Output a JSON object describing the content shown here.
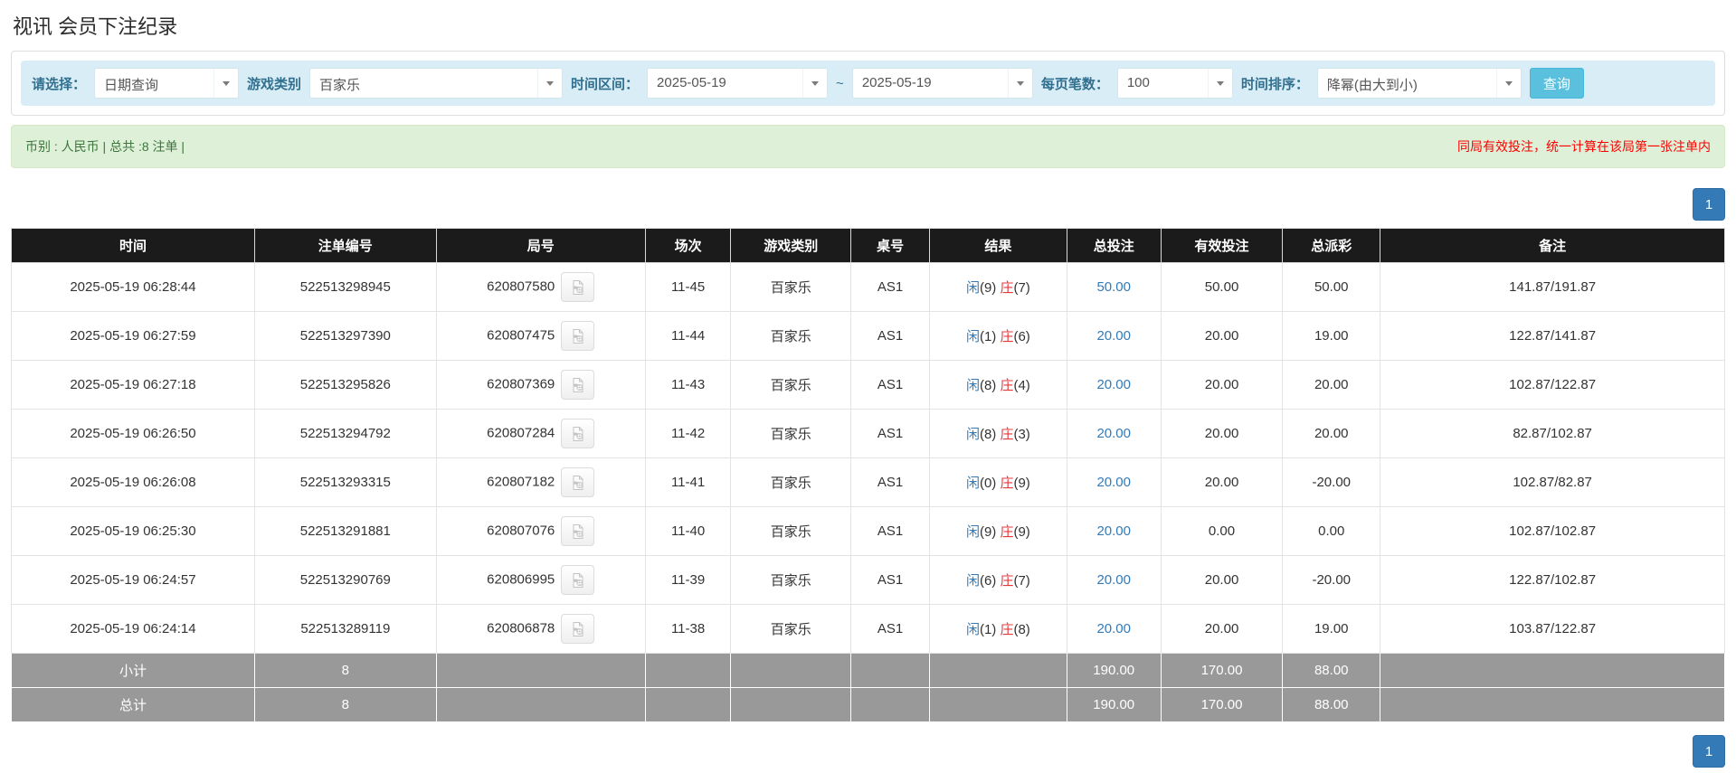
{
  "page": {
    "title": "视讯 会员下注纪录"
  },
  "filters": {
    "select_label": "请选择：",
    "select_value": "日期查询",
    "game_type_label": "游戏类别",
    "game_type_value": "百家乐",
    "time_range_label": "时间区间：",
    "date_from": "2025-05-19",
    "tilde": "~",
    "date_to": "2025-05-19",
    "page_size_label": "每页笔数：",
    "page_size_value": "100",
    "sort_label": "时间排序：",
    "sort_value": "降幂(由大到小)",
    "search_button": "查询"
  },
  "summary": {
    "left": "币别 : 人民币 | 总共 :8 注单 |",
    "right": "同局有效投注，统一计算在该局第一张注单内"
  },
  "pagination": {
    "page": "1"
  },
  "colors": {
    "accent_blue": "#337ab7",
    "button_cyan": "#5bc0de",
    "banker_red": "#e4393c",
    "negative_red": "#ff0000",
    "note_red": "#ff0000",
    "header_bg": "#1b1b1b",
    "footer_bg": "#999999",
    "filter_bg": "#d9edf7",
    "summary_bg": "#dff0d8"
  },
  "icons": {
    "video_icon": "video-replay-icon",
    "dropdown_icon": "chevron-down-icon"
  },
  "table": {
    "headers": [
      "时间",
      "注单编号",
      "局号",
      "场次",
      "游戏类别",
      "桌号",
      "结果",
      "总投注",
      "有效投注",
      "总派彩",
      "备注"
    ],
    "rows": [
      {
        "time": "2025-05-19 06:28:44",
        "bet_id": "522513298945",
        "round_id": "620807580",
        "session": "11-45",
        "game": "百家乐",
        "table": "AS1",
        "player": "闲",
        "player_n": "(9)",
        "banker": "庄",
        "banker_n": "(7)",
        "total_bet": "50.00",
        "valid_bet": "50.00",
        "payout": "50.00",
        "remark": "141.87/191.87"
      },
      {
        "time": "2025-05-19 06:27:59",
        "bet_id": "522513297390",
        "round_id": "620807475",
        "session": "11-44",
        "game": "百家乐",
        "table": "AS1",
        "player": "闲",
        "player_n": "(1)",
        "banker": "庄",
        "banker_n": "(6)",
        "total_bet": "20.00",
        "valid_bet": "20.00",
        "payout": "19.00",
        "remark": "122.87/141.87"
      },
      {
        "time": "2025-05-19 06:27:18",
        "bet_id": "522513295826",
        "round_id": "620807369",
        "session": "11-43",
        "game": "百家乐",
        "table": "AS1",
        "player": "闲",
        "player_n": "(8)",
        "banker": "庄",
        "banker_n": "(4)",
        "total_bet": "20.00",
        "valid_bet": "20.00",
        "payout": "20.00",
        "remark": "102.87/122.87"
      },
      {
        "time": "2025-05-19 06:26:50",
        "bet_id": "522513294792",
        "round_id": "620807284",
        "session": "11-42",
        "game": "百家乐",
        "table": "AS1",
        "player": "闲",
        "player_n": "(8)",
        "banker": "庄",
        "banker_n": "(3)",
        "total_bet": "20.00",
        "valid_bet": "20.00",
        "payout": "20.00",
        "remark": "82.87/102.87"
      },
      {
        "time": "2025-05-19 06:26:08",
        "bet_id": "522513293315",
        "round_id": "620807182",
        "session": "11-41",
        "game": "百家乐",
        "table": "AS1",
        "player": "闲",
        "player_n": "(0)",
        "banker": "庄",
        "banker_n": "(9)",
        "total_bet": "20.00",
        "valid_bet": "20.00",
        "payout": "-20.00",
        "remark": "102.87/82.87"
      },
      {
        "time": "2025-05-19 06:25:30",
        "bet_id": "522513291881",
        "round_id": "620807076",
        "session": "11-40",
        "game": "百家乐",
        "table": "AS1",
        "player": "闲",
        "player_n": "(9)",
        "banker": "庄",
        "banker_n": "(9)",
        "total_bet": "20.00",
        "valid_bet": "0.00",
        "payout": "0.00",
        "remark": "102.87/102.87"
      },
      {
        "time": "2025-05-19 06:24:57",
        "bet_id": "522513290769",
        "round_id": "620806995",
        "session": "11-39",
        "game": "百家乐",
        "table": "AS1",
        "player": "闲",
        "player_n": "(6)",
        "banker": "庄",
        "banker_n": "(7)",
        "total_bet": "20.00",
        "valid_bet": "20.00",
        "payout": "-20.00",
        "remark": "122.87/102.87"
      },
      {
        "time": "2025-05-19 06:24:14",
        "bet_id": "522513289119",
        "round_id": "620806878",
        "session": "11-38",
        "game": "百家乐",
        "table": "AS1",
        "player": "闲",
        "player_n": "(1)",
        "banker": "庄",
        "banker_n": "(8)",
        "total_bet": "20.00",
        "valid_bet": "20.00",
        "payout": "19.00",
        "remark": "103.87/122.87"
      }
    ],
    "footer": [
      {
        "label": "小计",
        "count": "8",
        "total_bet": "190.00",
        "valid_bet": "170.00",
        "payout": "88.00"
      },
      {
        "label": "总计",
        "count": "8",
        "total_bet": "190.00",
        "valid_bet": "170.00",
        "payout": "88.00"
      }
    ]
  }
}
